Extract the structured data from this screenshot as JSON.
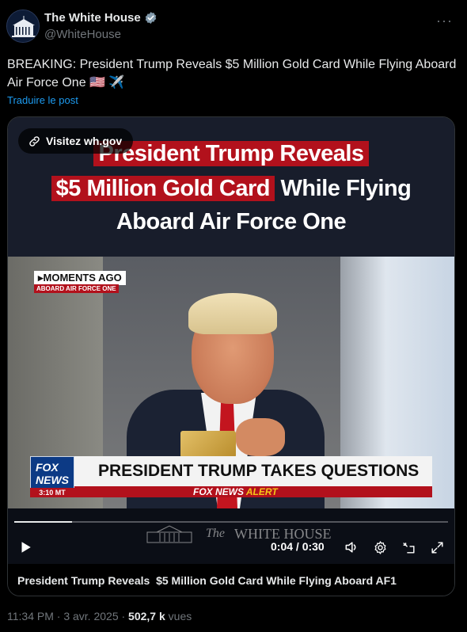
{
  "author": {
    "display_name": "The White House",
    "handle": "@WhiteHouse",
    "verified_icon": "verified-badge-icon",
    "avatar_icon": "white-house-logo-icon"
  },
  "more_icon": "more-horizontal-icon",
  "tweet": {
    "text": "BREAKING: President Trump Reveals $5 Million Gold Card While Flying Aboard Air Force One 🇺🇸 ✈️",
    "translate_link": "Traduire le post"
  },
  "media": {
    "link_chip": "Visitez wh.gov",
    "video_title": {
      "line1": "President Trump Reveals",
      "line2_highlight": "$5 Million Gold Card",
      "line2_rest": " While Flying",
      "line3": "Aboard Air Force One"
    },
    "overlay": {
      "moments": "▸MOMENTS AGO",
      "moments_sub": "ABOARD AIR FORCE ONE",
      "fox_logo_line1": "FOX",
      "fox_logo_line2": "NEWS",
      "fox_time": "3:10 MT",
      "lower_third": "PRESIDENT TRUMP TAKES QUESTIONS",
      "alert_prefix": "FOX NEWS ",
      "alert_word": "ALERT"
    },
    "watermark": {
      "the": "The",
      "name": "WHITE HOUSE"
    },
    "player": {
      "progress": 0.133,
      "current_time": "0:04",
      "duration": "0:30",
      "time_display": "0:04 / 0:30"
    },
    "caption": "President Trump Reveals  $5 Million Gold Card While Flying Aboard AF1"
  },
  "meta": {
    "time_date": "11:34 PM · 3 avr. 2025 · ",
    "views_count": "502,7 k",
    "views_label": " vues"
  },
  "colors": {
    "accent_blue": "#1d9bf0",
    "highlight_red": "#b2111c",
    "background": "#000000"
  }
}
